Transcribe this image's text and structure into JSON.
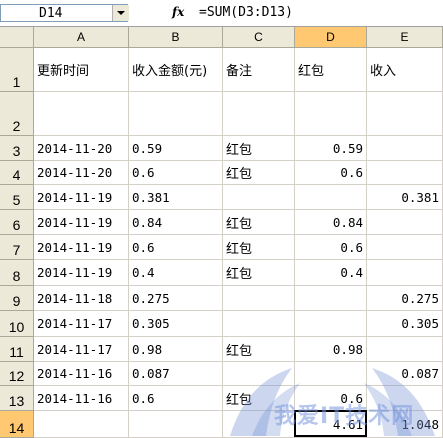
{
  "formula_bar": {
    "name_box": "D14",
    "fx_label": "fx",
    "formula": "=SUM(D3:D13)"
  },
  "columns": [
    "A",
    "B",
    "C",
    "D",
    "E"
  ],
  "selected_column": "D",
  "rows": [
    {
      "num": "1",
      "cells": [
        "更新时间",
        "收入金额(元)",
        "备注",
        "红包",
        "收入"
      ]
    },
    {
      "num": "2",
      "cells": [
        "",
        "",
        "",
        "",
        ""
      ]
    },
    {
      "num": "3",
      "cells": [
        "2014-11-20",
        "0.59",
        "红包",
        "0.59",
        ""
      ]
    },
    {
      "num": "4",
      "cells": [
        "2014-11-20",
        "0.6",
        "红包",
        "0.6",
        ""
      ]
    },
    {
      "num": "5",
      "cells": [
        "2014-11-19",
        "0.381",
        "",
        "",
        "0.381"
      ]
    },
    {
      "num": "6",
      "cells": [
        "2014-11-19",
        "0.84",
        "红包",
        "0.84",
        ""
      ]
    },
    {
      "num": "7",
      "cells": [
        "2014-11-19",
        "0.6",
        "红包",
        "0.6",
        ""
      ]
    },
    {
      "num": "8",
      "cells": [
        "2014-11-19",
        "0.4",
        "红包",
        "0.4",
        ""
      ]
    },
    {
      "num": "9",
      "cells": [
        "2014-11-18",
        "0.275",
        "",
        "",
        "0.275"
      ]
    },
    {
      "num": "10",
      "cells": [
        "2014-11-17",
        "0.305",
        "",
        "",
        "0.305"
      ]
    },
    {
      "num": "11",
      "cells": [
        "2014-11-17",
        "0.98",
        "红包",
        "0.98",
        ""
      ]
    },
    {
      "num": "12",
      "cells": [
        "2014-11-16",
        "0.087",
        "",
        "",
        "0.087"
      ]
    },
    {
      "num": "13",
      "cells": [
        "2014-11-16",
        "0.6",
        "红包",
        "0.6",
        ""
      ]
    },
    {
      "num": "14",
      "cells": [
        "",
        "",
        "",
        "4.61",
        "1.048"
      ]
    }
  ],
  "active_cell": "D14",
  "watermark": "我爱IT技术网"
}
